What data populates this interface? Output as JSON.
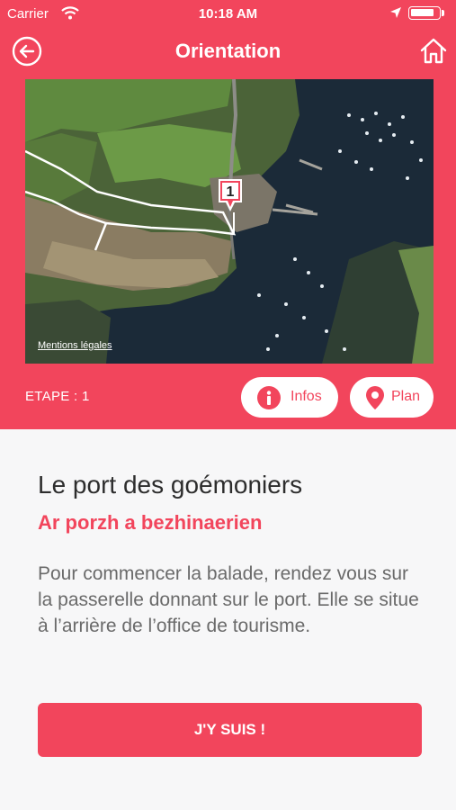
{
  "status_bar": {
    "carrier": "Carrier",
    "time": "10:18 AM",
    "battery_level": 0.85,
    "icons": [
      "wifi-icon",
      "location-arrow-icon",
      "battery-icon"
    ]
  },
  "nav": {
    "title": "Orientation",
    "back_icon": "circle-arrow-left-icon",
    "home_icon": "home-icon"
  },
  "map": {
    "marker_number": "1",
    "legal_link": "Mentions légales"
  },
  "step": {
    "label": "ETAPE : 1"
  },
  "actions": {
    "infos_label": "Infos",
    "infos_icon": "info-circle-icon",
    "plan_label": "Plan",
    "plan_icon": "map-pin-icon"
  },
  "poi": {
    "title": "Le port des goémoniers",
    "subtitle": "Ar porzh a bezhinaerien",
    "description": "Pour commencer la balade, rendez vous sur la passerelle donnant sur le port. Elle se situe à l’arrière de l’office de tourisme.",
    "cta_label": "J'Y SUIS !"
  },
  "colors": {
    "brand": "#f2455c",
    "background": "#f7f7f8",
    "title_text": "#2d2d2d",
    "body_text": "#6a6a6a",
    "sea": "#1b2a38",
    "land": "#4f6b3a"
  }
}
